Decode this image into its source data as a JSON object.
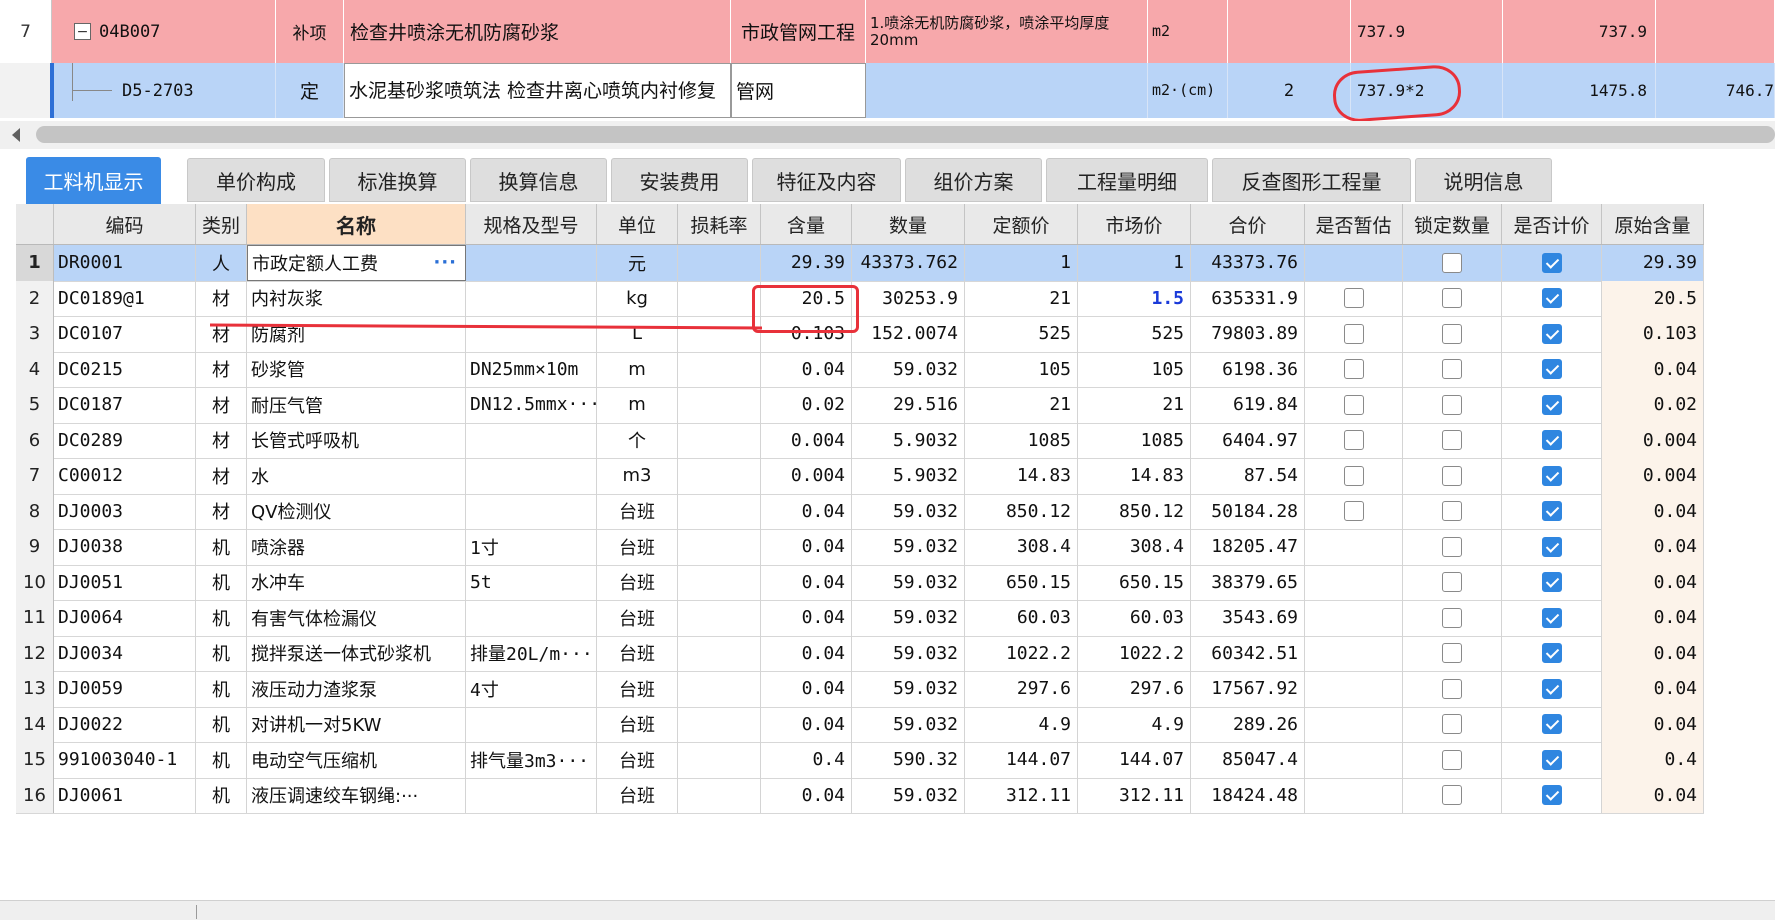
{
  "top_rows": [
    {
      "row_no": "7",
      "expander": "−",
      "code": "04B007",
      "type": "补项",
      "name": "检查井喷涂无机防腐砂浆",
      "specialty": "市政管网工程",
      "feature": "1.喷涂无机防腐砂浆，喷涂平均厚度20mm",
      "unit": "m2",
      "content": "",
      "quantity_expr": "737.9",
      "quantity": "737.9",
      "extra": ""
    },
    {
      "row_no": "",
      "code": "D5-2703",
      "type": "定",
      "name": "水泥基砂浆喷筑法 检查井离心喷筑内衬修复",
      "specialty": "管网",
      "feature": "",
      "unit": "m2·(cm)",
      "content": "2",
      "quantity_expr": "737.9*2",
      "quantity": "1475.8",
      "extra": "746.7"
    }
  ],
  "tabs": [
    {
      "label": "工料机显示",
      "active": true
    },
    {
      "label": "单价构成"
    },
    {
      "label": "标准换算"
    },
    {
      "label": "换算信息"
    },
    {
      "label": "安装费用"
    },
    {
      "label": "特征及内容"
    },
    {
      "label": "组价方案"
    },
    {
      "label": "工程量明细"
    },
    {
      "label": "反查图形工程量"
    },
    {
      "label": "说明信息"
    }
  ],
  "columns": [
    "编码",
    "类别",
    "名称",
    "规格及型号",
    "单位",
    "损耗率",
    "含量",
    "数量",
    "定额价",
    "市场价",
    "合价",
    "是否暂估",
    "锁定数量",
    "是否计价",
    "原始含量"
  ],
  "rows": [
    {
      "idx": "1",
      "code": "DR0001",
      "cat": "人",
      "name": "市政定额人工费",
      "spec": "",
      "unit": "元",
      "loss": "",
      "content": "29.39",
      "qty": "43373.762",
      "quota": "1",
      "market": "1",
      "total": "43373.76",
      "est": null,
      "lock": false,
      "priced": true,
      "orig": "29.39"
    },
    {
      "idx": "2",
      "code": "DC0189@1",
      "cat": "材",
      "name": "内衬灰浆",
      "spec": "",
      "unit": "kg",
      "loss": "",
      "content": "20.5",
      "qty": "30253.9",
      "quota": "21",
      "market": "1.5",
      "total": "635331.9",
      "est": false,
      "lock": false,
      "priced": true,
      "orig": "20.5"
    },
    {
      "idx": "3",
      "code": "DC0107",
      "cat": "材",
      "name": "防腐剂",
      "spec": "",
      "unit": "L",
      "loss": "",
      "content": "0.103",
      "qty": "152.0074",
      "quota": "525",
      "market": "525",
      "total": "79803.89",
      "est": false,
      "lock": false,
      "priced": true,
      "orig": "0.103"
    },
    {
      "idx": "4",
      "code": "DC0215",
      "cat": "材",
      "name": "砂浆管",
      "spec": "DN25mm×10m",
      "unit": "m",
      "loss": "",
      "content": "0.04",
      "qty": "59.032",
      "quota": "105",
      "market": "105",
      "total": "6198.36",
      "est": false,
      "lock": false,
      "priced": true,
      "orig": "0.04"
    },
    {
      "idx": "5",
      "code": "DC0187",
      "cat": "材",
      "name": "耐压气管",
      "spec": "DN12.5mmx···",
      "unit": "m",
      "loss": "",
      "content": "0.02",
      "qty": "29.516",
      "quota": "21",
      "market": "21",
      "total": "619.84",
      "est": false,
      "lock": false,
      "priced": true,
      "orig": "0.02"
    },
    {
      "idx": "6",
      "code": "DC0289",
      "cat": "材",
      "name": "长管式呼吸机",
      "spec": "",
      "unit": "个",
      "loss": "",
      "content": "0.004",
      "qty": "5.9032",
      "quota": "1085",
      "market": "1085",
      "total": "6404.97",
      "est": false,
      "lock": false,
      "priced": true,
      "orig": "0.004"
    },
    {
      "idx": "7",
      "code": "C00012",
      "cat": "材",
      "name": "水",
      "spec": "",
      "unit": "m3",
      "loss": "",
      "content": "0.004",
      "qty": "5.9032",
      "quota": "14.83",
      "market": "14.83",
      "total": "87.54",
      "est": false,
      "lock": false,
      "priced": true,
      "orig": "0.004"
    },
    {
      "idx": "8",
      "code": "DJ0003",
      "cat": "材",
      "name": "QV检测仪",
      "spec": "",
      "unit": "台班",
      "loss": "",
      "content": "0.04",
      "qty": "59.032",
      "quota": "850.12",
      "market": "850.12",
      "total": "50184.28",
      "est": false,
      "lock": false,
      "priced": true,
      "orig": "0.04"
    },
    {
      "idx": "9",
      "code": "DJ0038",
      "cat": "机",
      "name": "喷涂器",
      "spec": "1寸",
      "unit": "台班",
      "loss": "",
      "content": "0.04",
      "qty": "59.032",
      "quota": "308.4",
      "market": "308.4",
      "total": "18205.47",
      "est": null,
      "lock": false,
      "priced": true,
      "orig": "0.04"
    },
    {
      "idx": "10",
      "code": "DJ0051",
      "cat": "机",
      "name": "水冲车",
      "spec": "5t",
      "unit": "台班",
      "loss": "",
      "content": "0.04",
      "qty": "59.032",
      "quota": "650.15",
      "market": "650.15",
      "total": "38379.65",
      "est": null,
      "lock": false,
      "priced": true,
      "orig": "0.04"
    },
    {
      "idx": "11",
      "code": "DJ0064",
      "cat": "机",
      "name": "有害气体检漏仪",
      "spec": "",
      "unit": "台班",
      "loss": "",
      "content": "0.04",
      "qty": "59.032",
      "quota": "60.03",
      "market": "60.03",
      "total": "3543.69",
      "est": null,
      "lock": false,
      "priced": true,
      "orig": "0.04"
    },
    {
      "idx": "12",
      "code": "DJ0034",
      "cat": "机",
      "name": "搅拌泵送一体式砂浆机",
      "spec": "排量20L/m···",
      "unit": "台班",
      "loss": "",
      "content": "0.04",
      "qty": "59.032",
      "quota": "1022.2",
      "market": "1022.2",
      "total": "60342.51",
      "est": null,
      "lock": false,
      "priced": true,
      "orig": "0.04"
    },
    {
      "idx": "13",
      "code": "DJ0059",
      "cat": "机",
      "name": "液压动力渣浆泵",
      "spec": "4寸",
      "unit": "台班",
      "loss": "",
      "content": "0.04",
      "qty": "59.032",
      "quota": "297.6",
      "market": "297.6",
      "total": "17567.92",
      "est": null,
      "lock": false,
      "priced": true,
      "orig": "0.04"
    },
    {
      "idx": "14",
      "code": "DJ0022",
      "cat": "机",
      "name": "对讲机一对5KW",
      "spec": "",
      "unit": "台班",
      "loss": "",
      "content": "0.04",
      "qty": "59.032",
      "quota": "4.9",
      "market": "4.9",
      "total": "289.26",
      "est": null,
      "lock": false,
      "priced": true,
      "orig": "0.04"
    },
    {
      "idx": "15",
      "code": "991003040-1",
      "cat": "机",
      "name": "电动空气压缩机",
      "spec": "排气量3m3···",
      "unit": "台班",
      "loss": "",
      "content": "0.4",
      "qty": "590.32",
      "quota": "144.07",
      "market": "144.07",
      "total": "85047.4",
      "est": null,
      "lock": false,
      "priced": true,
      "orig": "0.4"
    },
    {
      "idx": "16",
      "code": "DJ0061",
      "cat": "机",
      "name": "液压调速绞车钢绳:···",
      "spec": "",
      "unit": "台班",
      "loss": "",
      "content": "0.04",
      "qty": "59.032",
      "quota": "312.11",
      "market": "312.11",
      "total": "18424.48",
      "est": null,
      "lock": false,
      "priced": true,
      "orig": "0.04"
    }
  ],
  "colors": {
    "accent": "#3a8be6",
    "selected_row": "#b9d4f7",
    "parent_row": "#f7a8ab",
    "annotation": "#e8313a",
    "market_changed": "#1a3ad9"
  }
}
